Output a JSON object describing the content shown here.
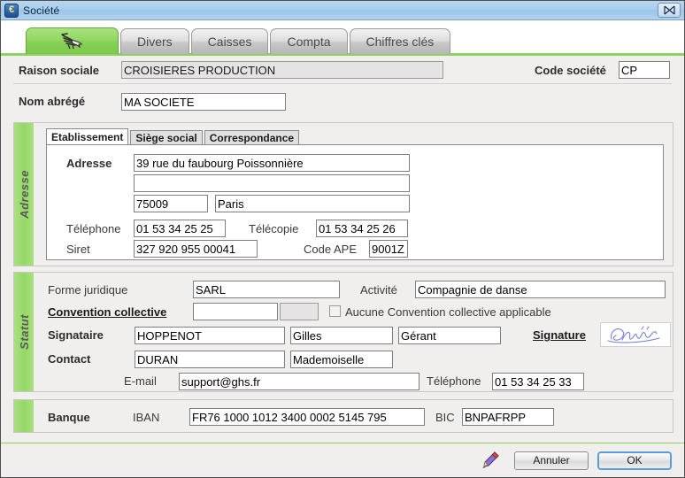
{
  "window": {
    "title": "Société",
    "icon": "euro-icon",
    "close_label": "✕"
  },
  "tabs": [
    {
      "label": "",
      "icon": "zebra-icon",
      "active": true
    },
    {
      "label": "Divers",
      "active": false
    },
    {
      "label": "Caisses",
      "active": false
    },
    {
      "label": "Compta",
      "active": false
    },
    {
      "label": "Chiffres clés",
      "active": false
    }
  ],
  "identity": {
    "raison_sociale_label": "Raison sociale",
    "raison_sociale_value": "CROISIERES PRODUCTION",
    "code_societe_label": "Code société",
    "code_societe_value": "CP",
    "nom_abrege_label": "Nom abrégé",
    "nom_abrege_value": "MA SOCIETE"
  },
  "adresse": {
    "section_label": "Adresse",
    "tabs": [
      {
        "label": "Etablissement",
        "active": true
      },
      {
        "label": "Siège social",
        "active": false
      },
      {
        "label": "Correspondance",
        "active": false
      }
    ],
    "adresse_label": "Adresse",
    "line1": "39 rue du faubourg Poissonnière",
    "line2": "",
    "code_postal": "75009",
    "ville": "Paris",
    "telephone_label": "Téléphone",
    "telephone": "01 53 34 25 25",
    "telecopie_label": "Télécopie",
    "telecopie": "01 53 34 25 26",
    "siret_label": "Siret",
    "siret": "327 920 955 00041",
    "code_ape_label": "Code APE",
    "code_ape": "9001Z"
  },
  "statut": {
    "section_label": "Statut",
    "forme_juridique_label": "Forme juridique",
    "forme_juridique": "SARL",
    "activite_label": "Activité",
    "activite": "Compagnie de danse",
    "convention_collective_label": "Convention collective",
    "convention_collective": "",
    "convention_collective_code": "",
    "aucune_convention_label": "Aucune Convention collective applicable",
    "aucune_convention_checked": false,
    "signataire_label": "Signataire",
    "signataire_nom": "HOPPENOT",
    "signataire_prenom": "Gilles",
    "signataire_fonction": "Gérant",
    "signature_label": "Signature",
    "signature_image": "handwritten-signature",
    "contact_label": "Contact",
    "contact_nom": "DURAN",
    "contact_civilite": "Mademoiselle",
    "email_label": "E-mail",
    "email": "support@ghs.fr",
    "telephone_label": "Téléphone",
    "telephone": "01 53 34 25 33"
  },
  "banque": {
    "section_label": "Banque",
    "iban_label": "IBAN",
    "iban": "FR76 1000 1012 3400 0002 5145 795",
    "bic_label": "BIC",
    "bic": "BNPAFRPP"
  },
  "footer": {
    "pencil_icon": "pencil-icon",
    "cancel_label": "Annuler",
    "ok_label": "OK"
  },
  "colors": {
    "accent_green": "#8ed160",
    "title_blue": "#a9cdea",
    "panel_bg": "#f0efee"
  }
}
